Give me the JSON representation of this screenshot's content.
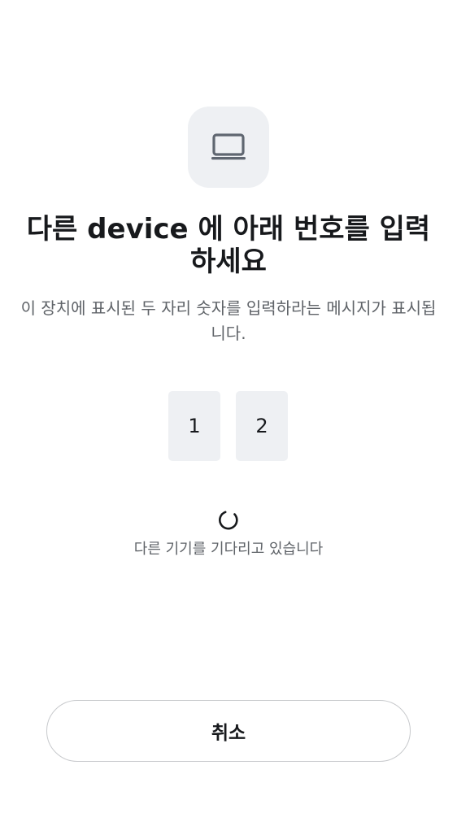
{
  "header": {
    "icon": "laptop-icon",
    "title": "다른 device 에 아래 번호를 입력하세요",
    "subtitle": "이 장치에 표시된 두 자리 숫자를 입력하라는 메시지가 표시됩니다."
  },
  "code": {
    "digits": [
      "1",
      "2"
    ]
  },
  "status": {
    "spinner_icon": "loading-spinner-icon",
    "waiting_text": "다른 기기를 기다리고 있습니다"
  },
  "actions": {
    "cancel_label": "취소"
  },
  "colors": {
    "icon_tile_bg": "#eef0f3",
    "text_primary": "#17191c",
    "text_secondary": "#5f6368",
    "button_border": "#c7c9cc"
  }
}
